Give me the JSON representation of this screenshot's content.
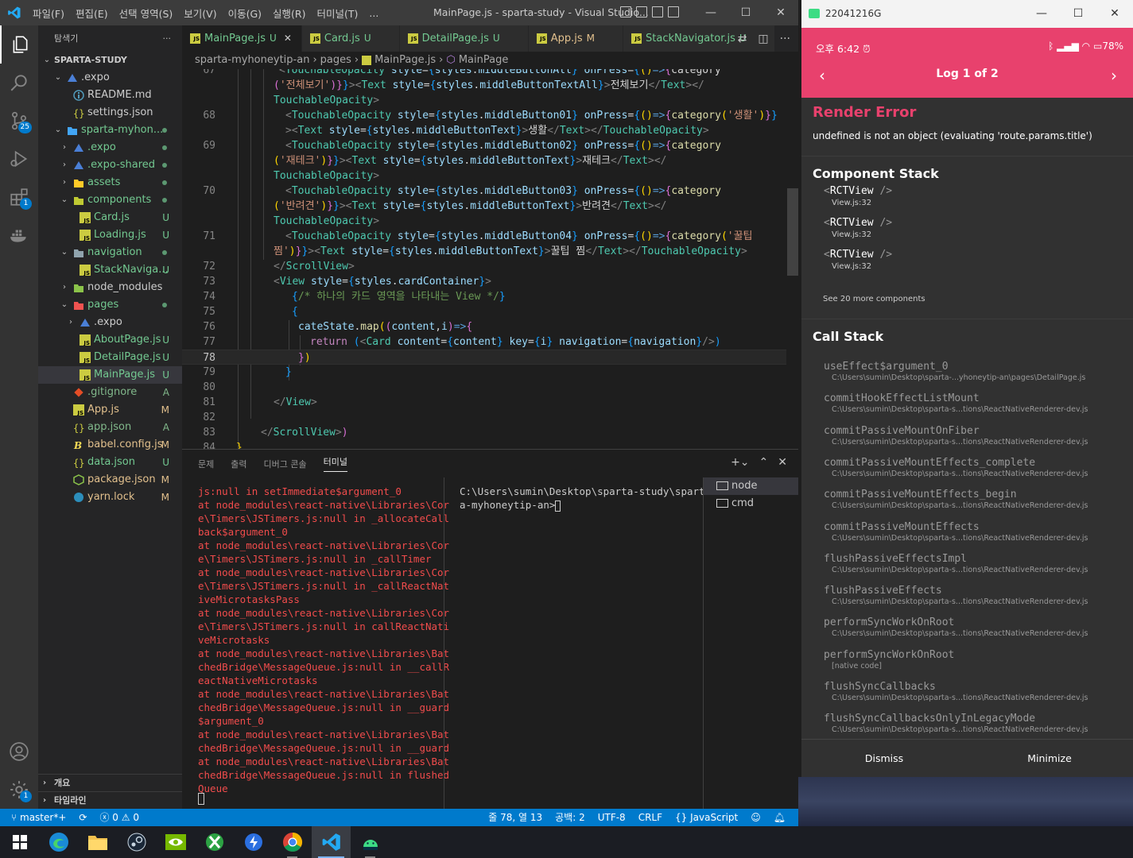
{
  "vscode": {
    "menu": [
      "파일(F)",
      "편집(E)",
      "선택 영역(S)",
      "보기(V)",
      "이동(G)",
      "실행(R)",
      "터미널(T)",
      "..."
    ],
    "window_title": "MainPage.js - sparta-study - Visual Studio...",
    "activity_badges": {
      "scm": "25",
      "extensions": "1",
      "settings": "1"
    },
    "explorer": {
      "header": "탐색기",
      "more": "···",
      "root": "SPARTA-STUDY",
      "items": [
        {
          "name": ".expo",
          "status": "",
          "indent": 1,
          "kind": "folder-open"
        },
        {
          "name": "README.md",
          "status": "",
          "indent": 2,
          "kind": "info"
        },
        {
          "name": "settings.json",
          "status": "",
          "indent": 2,
          "kind": "json"
        },
        {
          "name": "sparta-myhon...",
          "status": "dot",
          "indent": 1,
          "kind": "folder-open"
        },
        {
          "name": ".expo",
          "status": "dot",
          "indent": 2,
          "kind": "folder"
        },
        {
          "name": ".expo-shared",
          "status": "dot",
          "indent": 2,
          "kind": "folder"
        },
        {
          "name": "assets",
          "status": "dot",
          "indent": 2,
          "kind": "folder"
        },
        {
          "name": "components",
          "status": "dot",
          "indent": 2,
          "kind": "folder-open"
        },
        {
          "name": "Card.js",
          "status": "U",
          "indent": 3,
          "kind": "js"
        },
        {
          "name": "Loading.js",
          "status": "U",
          "indent": 3,
          "kind": "js"
        },
        {
          "name": "navigation",
          "status": "dot",
          "indent": 2,
          "kind": "folder-open"
        },
        {
          "name": "StackNaviga...",
          "status": "U",
          "indent": 3,
          "kind": "js"
        },
        {
          "name": "node_modules",
          "status": "",
          "indent": 2,
          "kind": "folder"
        },
        {
          "name": "pages",
          "status": "dot",
          "indent": 2,
          "kind": "folder-open"
        },
        {
          "name": ".expo",
          "status": "",
          "indent": 3,
          "kind": "folder"
        },
        {
          "name": "AboutPage.js",
          "status": "U",
          "indent": 3,
          "kind": "js"
        },
        {
          "name": "DetailPage.js",
          "status": "U",
          "indent": 3,
          "kind": "js"
        },
        {
          "name": "MainPage.js",
          "status": "U",
          "indent": 3,
          "kind": "js",
          "selected": true
        },
        {
          "name": ".gitignore",
          "status": "A",
          "indent": 2,
          "kind": "git"
        },
        {
          "name": "App.js",
          "status": "M",
          "indent": 2,
          "kind": "js"
        },
        {
          "name": "app.json",
          "status": "A",
          "indent": 2,
          "kind": "json"
        },
        {
          "name": "babel.config.js",
          "status": "M",
          "indent": 2,
          "kind": "babel"
        },
        {
          "name": "data.json",
          "status": "U",
          "indent": 2,
          "kind": "json"
        },
        {
          "name": "package.json",
          "status": "M",
          "indent": 2,
          "kind": "node"
        },
        {
          "name": "yarn.lock",
          "status": "M",
          "indent": 2,
          "kind": "yarn"
        }
      ],
      "outline": "개요",
      "timeline": "타임라인"
    },
    "tabs": [
      {
        "label": "MainPage.js",
        "status": "U",
        "active": true
      },
      {
        "label": "Card.js",
        "status": "U"
      },
      {
        "label": "DetailPage.js",
        "status": "U"
      },
      {
        "label": "App.js",
        "status": "M"
      },
      {
        "label": "StackNavigator.js",
        "status": "U"
      }
    ],
    "breadcrumb": [
      "sparta-myhoneytip-an",
      "pages",
      "MainPage.js",
      "MainPage"
    ],
    "current_line": "78",
    "panel": {
      "tabs": [
        "문제",
        "출력",
        "디버그 콘솔",
        "터미널"
      ],
      "active_tab": "터미널",
      "terminal_left": "js:null in setImmediate$argument_0\nat node_modules\\react-native\\Libraries\\Cor\ne\\Timers\\JSTimers.js:null in _allocateCall\nback$argument_0\nat node_modules\\react-native\\Libraries\\Cor\ne\\Timers\\JSTimers.js:null in _callTimer\nat node_modules\\react-native\\Libraries\\Cor\ne\\Timers\\JSTimers.js:null in _callReactNat\niveMicrotasksPass\nat node_modules\\react-native\\Libraries\\Cor\ne\\Timers\\JSTimers.js:null in callReactNati\nveMicrotasks\nat node_modules\\react-native\\Libraries\\Bat\nchedBridge\\MessageQueue.js:null in __callR\neactNativeMicrotasks\nat node_modules\\react-native\\Libraries\\Bat\nchedBridge\\MessageQueue.js:null in __guard\n$argument_0\nat node_modules\\react-native\\Libraries\\Bat\nchedBridge\\MessageQueue.js:null in __guard\nat node_modules\\react-native\\Libraries\\Bat\nchedBridge\\MessageQueue.js:null in flushed\nQueue",
      "terminal_right": "C:\\Users\\sumin\\Desktop\\sparta-study\\spart\na-myhoneytip-an>",
      "terminals": [
        "node",
        "cmd"
      ]
    },
    "status": {
      "branch": "master*+",
      "errors": "0",
      "warnings": "0",
      "position": "줄 78, 열 13",
      "spaces": "공백: 2",
      "encoding": "UTF-8",
      "eol": "CRLF",
      "language": "JavaScript"
    }
  },
  "emulator": {
    "window_title": "22041216G",
    "status_time": "오후 6:42",
    "battery": "78",
    "nav_title": "Log 1 of 2",
    "error_title": "Render Error",
    "error_message": "undefined is not an object (evaluating 'route.params.title')",
    "component_stack_title": "Component Stack",
    "component_stack": [
      {
        "name": "RCTView",
        "loc": "View.js:32"
      },
      {
        "name": "RCTView",
        "loc": "View.js:32"
      },
      {
        "name": "RCTView",
        "loc": "View.js:32"
      }
    ],
    "see_more": "See 20 more components",
    "call_stack_title": "Call Stack",
    "call_stack": [
      {
        "fn": "useEffect$argument_0",
        "path": "C:\\Users\\sumin\\Desktop\\sparta-...yhoneytip-an\\pages\\DetailPage.js"
      },
      {
        "fn": "commitHookEffectListMount",
        "path": "C:\\Users\\sumin\\Desktop\\sparta-s...tions\\ReactNativeRenderer-dev.js"
      },
      {
        "fn": "commitPassiveMountOnFiber",
        "path": "C:\\Users\\sumin\\Desktop\\sparta-s...tions\\ReactNativeRenderer-dev.js"
      },
      {
        "fn": "commitPassiveMountEffects_complete",
        "path": "C:\\Users\\sumin\\Desktop\\sparta-s...tions\\ReactNativeRenderer-dev.js"
      },
      {
        "fn": "commitPassiveMountEffects_begin",
        "path": "C:\\Users\\sumin\\Desktop\\sparta-s...tions\\ReactNativeRenderer-dev.js"
      },
      {
        "fn": "commitPassiveMountEffects",
        "path": "C:\\Users\\sumin\\Desktop\\sparta-s...tions\\ReactNativeRenderer-dev.js"
      },
      {
        "fn": "flushPassiveEffectsImpl",
        "path": "C:\\Users\\sumin\\Desktop\\sparta-s...tions\\ReactNativeRenderer-dev.js"
      },
      {
        "fn": "flushPassiveEffects",
        "path": "C:\\Users\\sumin\\Desktop\\sparta-s...tions\\ReactNativeRenderer-dev.js"
      },
      {
        "fn": "performSyncWorkOnRoot",
        "path": "C:\\Users\\sumin\\Desktop\\sparta-s...tions\\ReactNativeRenderer-dev.js"
      },
      {
        "fn": "performSyncWorkOnRoot",
        "path": "[native code]"
      },
      {
        "fn": "flushSyncCallbacks",
        "path": "C:\\Users\\sumin\\Desktop\\sparta-s...tions\\ReactNativeRenderer-dev.js"
      },
      {
        "fn": "flushSyncCallbacksOnlyInLegacyMode",
        "path": "C:\\Users\\sumin\\Desktop\\sparta-s...tions\\ReactNativeRenderer-dev.js"
      }
    ],
    "dismiss": "Dismiss",
    "minimize": "Minimize"
  },
  "taskbar": [
    "windows-start",
    "edge",
    "file-explorer",
    "steam",
    "nvidia",
    "xbox",
    "app-blue",
    "chrome",
    "vscode",
    "android-emulator"
  ]
}
